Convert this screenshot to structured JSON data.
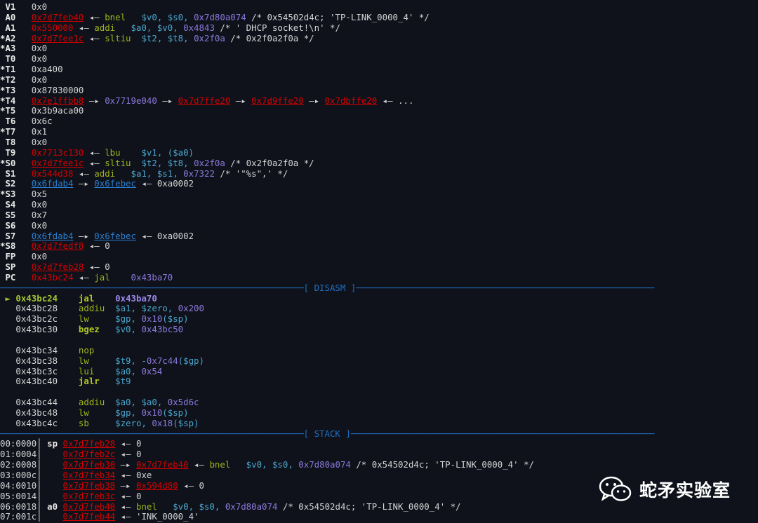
{
  "sections": [
    {
      "name": "registers",
      "lines": [
        {
          "s": [
            [
              " V1   ",
              "lb"
            ],
            [
              "0x0",
              "w"
            ]
          ]
        },
        {
          "s": [
            [
              " A0   ",
              "lb"
            ],
            [
              "0x7d7feb40",
              "ru"
            ],
            [
              " ◂— ",
              "w"
            ],
            [
              "bnel",
              "g"
            ],
            [
              "   ",
              "w"
            ],
            [
              "$v0, $s0, ",
              "c"
            ],
            [
              "0x7d80a074",
              "p"
            ],
            [
              " /* 0x54502d4c; 'TP-LINK_0000_4' */",
              "w"
            ]
          ]
        },
        {
          "s": [
            [
              " A1   ",
              "lb"
            ],
            [
              "0x550000",
              "r"
            ],
            [
              " ◂— ",
              "w"
            ],
            [
              "addi",
              "g"
            ],
            [
              "   ",
              "w"
            ],
            [
              "$a0, $v0, ",
              "c"
            ],
            [
              "0x4843",
              "p"
            ],
            [
              " /* ' DHCP socket!\\n' */",
              "w"
            ]
          ]
        },
        {
          "s": [
            [
              "*A2   ",
              "lb"
            ],
            [
              "0x7d7fee1c",
              "ru"
            ],
            [
              " ◂— ",
              "w"
            ],
            [
              "sltiu",
              "g"
            ],
            [
              "  ",
              "w"
            ],
            [
              "$t2, $t8, ",
              "c"
            ],
            [
              "0x2f0a",
              "p"
            ],
            [
              " /* 0x2f0a2f0a */",
              "w"
            ]
          ]
        },
        {
          "s": [
            [
              "*A3   ",
              "lb"
            ],
            [
              "0x0",
              "w"
            ]
          ]
        },
        {
          "s": [
            [
              " T0   ",
              "lb"
            ],
            [
              "0x0",
              "w"
            ]
          ]
        },
        {
          "s": [
            [
              "*T1   ",
              "lb"
            ],
            [
              "0xa400",
              "w"
            ]
          ]
        },
        {
          "s": [
            [
              "*T2   ",
              "lb"
            ],
            [
              "0x0",
              "w"
            ]
          ]
        },
        {
          "s": [
            [
              "*T3   ",
              "lb"
            ],
            [
              "0x87830000",
              "w"
            ]
          ]
        },
        {
          "s": [
            [
              "*T4   ",
              "lb"
            ],
            [
              "0x7e1ffbb8",
              "ru"
            ],
            [
              " —▸ ",
              "w"
            ],
            [
              "0x7719e040",
              "p"
            ],
            [
              " —▸ ",
              "w"
            ],
            [
              "0x7d7ffe20",
              "ru"
            ],
            [
              " —▸ ",
              "w"
            ],
            [
              "0x7d9ffe20",
              "ru"
            ],
            [
              " —▸ ",
              "w"
            ],
            [
              "0x7dbffe20",
              "ru"
            ],
            [
              " ◂— ...",
              "w"
            ]
          ]
        },
        {
          "s": [
            [
              "*T5   ",
              "lb"
            ],
            [
              "0x3b9aca00",
              "w"
            ]
          ]
        },
        {
          "s": [
            [
              " T6   ",
              "lb"
            ],
            [
              "0x6c",
              "w"
            ]
          ]
        },
        {
          "s": [
            [
              "*T7   ",
              "lb"
            ],
            [
              "0x1",
              "w"
            ]
          ]
        },
        {
          "s": [
            [
              " T8   ",
              "lb"
            ],
            [
              "0x0",
              "w"
            ]
          ]
        },
        {
          "s": [
            [
              " T9   ",
              "lb"
            ],
            [
              "0x7713c130",
              "r"
            ],
            [
              " ◂— ",
              "w"
            ],
            [
              "lbu",
              "g"
            ],
            [
              "    ",
              "w"
            ],
            [
              "$v1, ($a0)",
              "c"
            ]
          ]
        },
        {
          "s": [
            [
              "*S0   ",
              "lb"
            ],
            [
              "0x7d7fee1c",
              "ru"
            ],
            [
              " ◂— ",
              "w"
            ],
            [
              "sltiu",
              "g"
            ],
            [
              "  ",
              "w"
            ],
            [
              "$t2, $t8, ",
              "c"
            ],
            [
              "0x2f0a",
              "p"
            ],
            [
              " /* 0x2f0a2f0a */",
              "w"
            ]
          ]
        },
        {
          "s": [
            [
              " S1   ",
              "lb"
            ],
            [
              "0x544d38",
              "r"
            ],
            [
              " ◂— ",
              "w"
            ],
            [
              "addi",
              "g"
            ],
            [
              "   ",
              "w"
            ],
            [
              "$a1, $s1, ",
              "c"
            ],
            [
              "0x7322",
              "p"
            ],
            [
              " /* '\"%s\",' */",
              "w"
            ]
          ]
        },
        {
          "s": [
            [
              " S2   ",
              "lb"
            ],
            [
              "0x6fdab4",
              "bu"
            ],
            [
              " —▸ ",
              "w"
            ],
            [
              "0x6febec",
              "bu"
            ],
            [
              " ◂— 0xa0002",
              "w"
            ]
          ]
        },
        {
          "s": [
            [
              "*S3   ",
              "lb"
            ],
            [
              "0x5",
              "w"
            ]
          ]
        },
        {
          "s": [
            [
              " S4   ",
              "lb"
            ],
            [
              "0x0",
              "w"
            ]
          ]
        },
        {
          "s": [
            [
              " S5   ",
              "lb"
            ],
            [
              "0x7",
              "w"
            ]
          ]
        },
        {
          "s": [
            [
              " S6   ",
              "lb"
            ],
            [
              "0x0",
              "w"
            ]
          ]
        },
        {
          "s": [
            [
              " S7   ",
              "lb"
            ],
            [
              "0x6fdab4",
              "bu"
            ],
            [
              " —▸ ",
              "w"
            ],
            [
              "0x6febec",
              "bu"
            ],
            [
              " ◂— 0xa0002",
              "w"
            ]
          ]
        },
        {
          "s": [
            [
              "*S8   ",
              "lb"
            ],
            [
              "0x7d7fedf8",
              "ru"
            ],
            [
              " ◂— 0",
              "w"
            ]
          ]
        },
        {
          "s": [
            [
              " FP   ",
              "lb"
            ],
            [
              "0x0",
              "w"
            ]
          ]
        },
        {
          "s": [
            [
              " SP   ",
              "lb"
            ],
            [
              "0x7d7feb28",
              "ru"
            ],
            [
              " ◂— 0",
              "w"
            ]
          ]
        },
        {
          "s": [
            [
              " PC   ",
              "lb"
            ],
            [
              "0x43bc24",
              "r"
            ],
            [
              " ◂— ",
              "w"
            ],
            [
              "jal",
              "g"
            ],
            [
              "    ",
              "w"
            ],
            [
              "0x43ba70",
              "p"
            ]
          ]
        }
      ]
    },
    {
      "name": "disasm-separator",
      "lines": [
        {
          "s": [
            [
              "──────────────────────────────────────────────────────────",
              "sep"
            ],
            [
              "[ DISASM ]",
              "sep"
            ],
            [
              "─────────────────────────────────────────────────────────",
              "sep"
            ]
          ]
        }
      ]
    },
    {
      "name": "disasm",
      "lines": [
        {
          "s": [
            [
              " ► ",
              "ga"
            ],
            [
              "0x43bc24",
              "ga"
            ],
            [
              "    ",
              "w"
            ],
            [
              "jal",
              "gb"
            ],
            [
              "    ",
              "w"
            ],
            [
              "0x43ba70",
              "pb"
            ]
          ]
        },
        {
          "s": [
            [
              "   0x43bc28    ",
              "w"
            ],
            [
              "addiu",
              "g"
            ],
            [
              "  ",
              "w"
            ],
            [
              "$a1, $zero, ",
              "c"
            ],
            [
              "0x200",
              "p"
            ]
          ]
        },
        {
          "s": [
            [
              "   0x43bc2c    ",
              "w"
            ],
            [
              "lw",
              "g"
            ],
            [
              "     ",
              "w"
            ],
            [
              "$gp, ",
              "c"
            ],
            [
              "0x10",
              "p"
            ],
            [
              "($sp)",
              "c"
            ]
          ]
        },
        {
          "s": [
            [
              "   0x43bc30    ",
              "w"
            ],
            [
              "bgez",
              "gb"
            ],
            [
              "   ",
              "w"
            ],
            [
              "$v0, ",
              "c"
            ],
            [
              "0x43bc50",
              "p"
            ]
          ]
        },
        {
          "s": []
        },
        {
          "s": [
            [
              "   0x43bc34    ",
              "w"
            ],
            [
              "nop",
              "g"
            ]
          ]
        },
        {
          "s": [
            [
              "   0x43bc38    ",
              "w"
            ],
            [
              "lw",
              "g"
            ],
            [
              "     ",
              "w"
            ],
            [
              "$t9, -",
              "c"
            ],
            [
              "0x7c44",
              "p"
            ],
            [
              "($gp)",
              "c"
            ]
          ]
        },
        {
          "s": [
            [
              "   0x43bc3c    ",
              "w"
            ],
            [
              "lui",
              "g"
            ],
            [
              "    ",
              "w"
            ],
            [
              "$a0, ",
              "c"
            ],
            [
              "0x54",
              "p"
            ]
          ]
        },
        {
          "s": [
            [
              "   0x43bc40    ",
              "w"
            ],
            [
              "jalr",
              "gb"
            ],
            [
              "   ",
              "w"
            ],
            [
              "$t9",
              "c"
            ]
          ]
        },
        {
          "s": []
        },
        {
          "s": [
            [
              "   0x43bc44    ",
              "w"
            ],
            [
              "addiu",
              "g"
            ],
            [
              "  ",
              "w"
            ],
            [
              "$a0, $a0, ",
              "c"
            ],
            [
              "0x5d6c",
              "p"
            ]
          ]
        },
        {
          "s": [
            [
              "   0x43bc48    ",
              "w"
            ],
            [
              "lw",
              "g"
            ],
            [
              "     ",
              "w"
            ],
            [
              "$gp, ",
              "c"
            ],
            [
              "0x10",
              "p"
            ],
            [
              "($sp)",
              "c"
            ]
          ]
        },
        {
          "s": [
            [
              "   0x43bc4c    ",
              "w"
            ],
            [
              "sb",
              "g"
            ],
            [
              "     ",
              "w"
            ],
            [
              "$zero, ",
              "c"
            ],
            [
              "0x18",
              "p"
            ],
            [
              "($sp)",
              "c"
            ]
          ]
        }
      ]
    },
    {
      "name": "stack-separator",
      "lines": [
        {
          "s": [
            [
              "──────────────────────────────────────────────────────────",
              "sep"
            ],
            [
              "[ STACK ]",
              "sep"
            ],
            [
              "──────────────────────────────────────────────────────────",
              "sep"
            ]
          ]
        }
      ]
    },
    {
      "name": "stack",
      "lines": [
        {
          "s": [
            [
              "00:0000│ ",
              "w"
            ],
            [
              "sp ",
              "lb"
            ],
            [
              "0x7d7feb28",
              "ru"
            ],
            [
              " ◂— 0",
              "w"
            ]
          ]
        },
        {
          "s": [
            [
              "01:0004│    ",
              "w"
            ],
            [
              "0x7d7feb2c",
              "ru"
            ],
            [
              " ◂— 0",
              "w"
            ]
          ]
        },
        {
          "s": [
            [
              "02:0008│    ",
              "w"
            ],
            [
              "0x7d7feb30",
              "ru"
            ],
            [
              " —▸ ",
              "w"
            ],
            [
              "0x7d7feb40",
              "ru"
            ],
            [
              " ◂— ",
              "w"
            ],
            [
              "bnel",
              "g"
            ],
            [
              "   ",
              "w"
            ],
            [
              "$v0, $s0, ",
              "c"
            ],
            [
              "0x7d80a074",
              "p"
            ],
            [
              " /* 0x54502d4c; 'TP-LINK_0000_4' */",
              "w"
            ]
          ]
        },
        {
          "s": [
            [
              "03:000c│    ",
              "w"
            ],
            [
              "0x7d7feb34",
              "ru"
            ],
            [
              " ◂— 0xe",
              "w"
            ]
          ]
        },
        {
          "s": [
            [
              "04:0010│    ",
              "w"
            ],
            [
              "0x7d7feb38",
              "ru"
            ],
            [
              " —▸ ",
              "w"
            ],
            [
              "0x594d80",
              "ru"
            ],
            [
              " ◂— 0",
              "w"
            ]
          ]
        },
        {
          "s": [
            [
              "05:0014│    ",
              "w"
            ],
            [
              "0x7d7feb3c",
              "ru"
            ],
            [
              " ◂— 0",
              "w"
            ]
          ]
        },
        {
          "s": [
            [
              "06:0018│ ",
              "w"
            ],
            [
              "a0 ",
              "lb"
            ],
            [
              "0x7d7feb40",
              "ru"
            ],
            [
              " ◂— ",
              "w"
            ],
            [
              "bnel",
              "g"
            ],
            [
              "   ",
              "w"
            ],
            [
              "$v0, $s0, ",
              "c"
            ],
            [
              "0x7d80a074",
              "p"
            ],
            [
              " /* 0x54502d4c; 'TP-LINK_0000_4' */",
              "w"
            ]
          ]
        },
        {
          "s": [
            [
              "07:001c│    ",
              "w"
            ],
            [
              "0x7d7feb44",
              "ru"
            ],
            [
              " ◂— 'INK_0000_4'",
              "w"
            ]
          ]
        }
      ]
    }
  ],
  "watermark": {
    "icon": "wechat-icon",
    "text": "蛇矛实验室"
  },
  "colors": {
    "background": "#0f121b",
    "red": "#d40000",
    "purple": "#8c78dc",
    "green": "#9fb31a",
    "cyan": "#4aa6cc",
    "blue": "#2a7fd0",
    "separator": "#1f6fbf"
  }
}
